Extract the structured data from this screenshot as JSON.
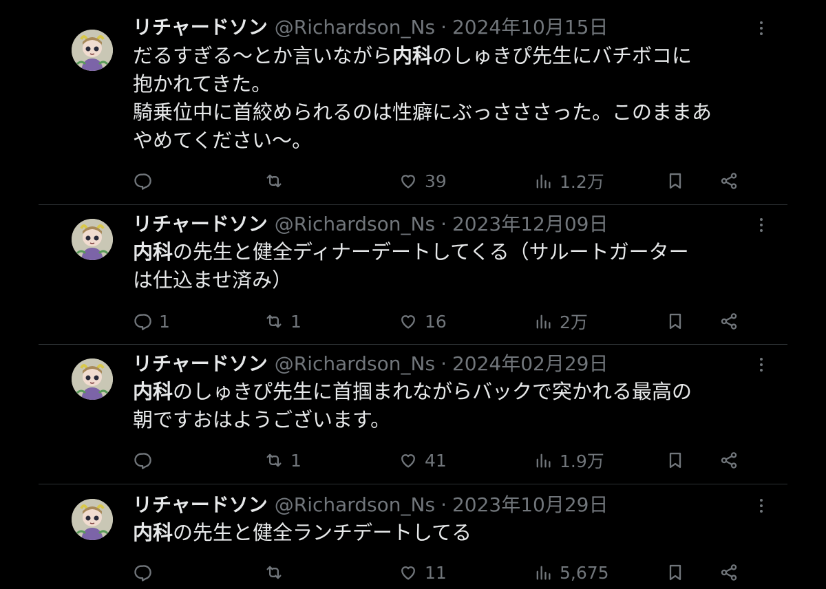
{
  "posts": [
    {
      "name": "リチャードソン",
      "handle": "@Richardson_Ns",
      "separator": "·",
      "date": "2024年10月15日",
      "text_segments": [
        {
          "text": "だるすぎる〜とか言いながら",
          "bold": false
        },
        {
          "text": "内科",
          "bold": true
        },
        {
          "text": "のしゅきぴ先生にバチボコに\n抱かれてきた。\n騎乗位中に首絞められるのは性癖にぶっさささった。このままあ\nやめてください〜。",
          "bold": false
        }
      ],
      "replies": "",
      "reposts": "",
      "likes": "39",
      "views": "1.2万"
    },
    {
      "name": "リチャードソン",
      "handle": "@Richardson_Ns",
      "separator": "·",
      "date": "2023年12月09日",
      "text_segments": [
        {
          "text": "内科",
          "bold": true
        },
        {
          "text": "の先生と健全ディナーデートしてくる（サルートガーター\nは仕込ませ済み）",
          "bold": false
        }
      ],
      "replies": "1",
      "reposts": "1",
      "likes": "16",
      "views": "2万"
    },
    {
      "name": "リチャードソン",
      "handle": "@Richardson_Ns",
      "separator": "·",
      "date": "2024年02月29日",
      "text_segments": [
        {
          "text": "内科",
          "bold": true
        },
        {
          "text": "のしゅきぴ先生に首掴まれながらバックで突かれる最高の\n朝ですおはようございます。",
          "bold": false
        }
      ],
      "replies": "",
      "reposts": "1",
      "likes": "41",
      "views": "1.9万"
    },
    {
      "name": "リチャードソン",
      "handle": "@Richardson_Ns",
      "separator": "·",
      "date": "2023年10月29日",
      "text_segments": [
        {
          "text": "内科",
          "bold": true
        },
        {
          "text": "の先生と健全ランチデートしてる",
          "bold": false
        }
      ],
      "replies": "",
      "reposts": "",
      "likes": "11",
      "views": "5,675"
    }
  ],
  "icons": {
    "reply": "speech-bubble-icon",
    "repost": "repost-arrows-icon",
    "like": "heart-icon",
    "views": "bar-chart-icon",
    "bookmark": "bookmark-icon",
    "share": "share-nodes-icon",
    "more": "vertical-ellipsis-icon"
  },
  "colors": {
    "background": "#000000",
    "text_primary": "#e7e9ea",
    "text_secondary": "#71767b",
    "divider": "#2f3336"
  }
}
